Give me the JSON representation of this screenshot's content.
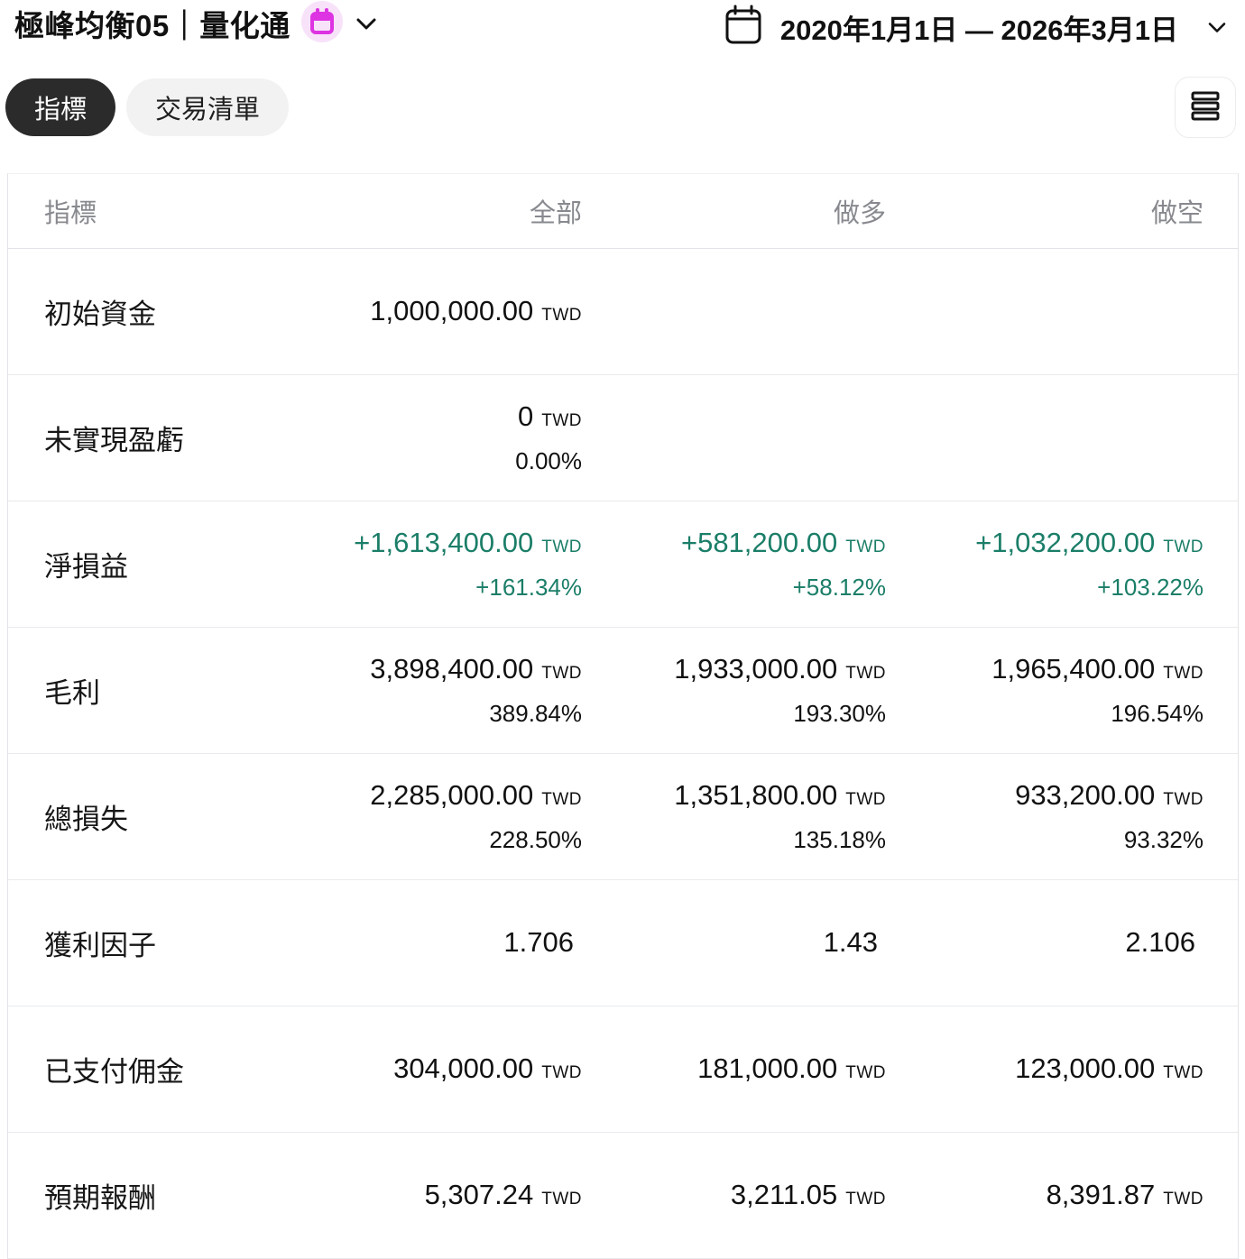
{
  "header": {
    "title": "極峰均衡05｜量化通",
    "date_range": "2020年1月1日 — 2026年3月1日"
  },
  "tabs": [
    {
      "label": "指標",
      "active": true
    },
    {
      "label": "交易清單",
      "active": false
    }
  ],
  "icons": {
    "title_badge": "calendar-badge-icon",
    "title_chevron": "chevron-down-icon",
    "date_calendar": "calendar-icon",
    "date_chevron": "chevron-down-icon",
    "view_toggle": "rows-list-icon"
  },
  "colors": {
    "positive": "#1b7e68",
    "badge_pink": "#f8e2fa",
    "badge_magenta": "#dd33e2",
    "tab_active_bg": "#2b2b2b",
    "tab_inactive_bg": "#f2f2f2",
    "header_text": "#87898e",
    "border": "#e2e4e8"
  },
  "table": {
    "columns": [
      "指標",
      "全部",
      "做多",
      "做空"
    ],
    "rows": [
      {
        "label": "初始資金",
        "positive": false,
        "cells": [
          {
            "value": "1,000,000.00",
            "unit": "TWD",
            "pct": ""
          },
          null,
          null
        ]
      },
      {
        "label": "未實現盈虧",
        "positive": false,
        "cells": [
          {
            "value": "0",
            "unit": "TWD",
            "pct": "0.00%"
          },
          null,
          null
        ]
      },
      {
        "label": "淨損益",
        "positive": true,
        "cells": [
          {
            "value": "+1,613,400.00",
            "unit": "TWD",
            "pct": "+161.34%"
          },
          {
            "value": "+581,200.00",
            "unit": "TWD",
            "pct": "+58.12%"
          },
          {
            "value": "+1,032,200.00",
            "unit": "TWD",
            "pct": "+103.22%"
          }
        ]
      },
      {
        "label": "毛利",
        "positive": false,
        "cells": [
          {
            "value": "3,898,400.00",
            "unit": "TWD",
            "pct": "389.84%"
          },
          {
            "value": "1,933,000.00",
            "unit": "TWD",
            "pct": "193.30%"
          },
          {
            "value": "1,965,400.00",
            "unit": "TWD",
            "pct": "196.54%"
          }
        ]
      },
      {
        "label": "總損失",
        "positive": false,
        "cells": [
          {
            "value": "2,285,000.00",
            "unit": "TWD",
            "pct": "228.50%"
          },
          {
            "value": "1,351,800.00",
            "unit": "TWD",
            "pct": "135.18%"
          },
          {
            "value": "933,200.00",
            "unit": "TWD",
            "pct": "93.32%"
          }
        ]
      },
      {
        "label": "獲利因子",
        "positive": false,
        "cells": [
          {
            "value": "1.706",
            "unit": "",
            "pct": ""
          },
          {
            "value": "1.43",
            "unit": "",
            "pct": ""
          },
          {
            "value": "2.106",
            "unit": "",
            "pct": ""
          }
        ]
      },
      {
        "label": "已支付佣金",
        "positive": false,
        "cells": [
          {
            "value": "304,000.00",
            "unit": "TWD",
            "pct": ""
          },
          {
            "value": "181,000.00",
            "unit": "TWD",
            "pct": ""
          },
          {
            "value": "123,000.00",
            "unit": "TWD",
            "pct": ""
          }
        ]
      },
      {
        "label": "預期報酬",
        "positive": false,
        "cells": [
          {
            "value": "5,307.24",
            "unit": "TWD",
            "pct": ""
          },
          {
            "value": "3,211.05",
            "unit": "TWD",
            "pct": ""
          },
          {
            "value": "8,391.87",
            "unit": "TWD",
            "pct": ""
          }
        ]
      }
    ]
  }
}
